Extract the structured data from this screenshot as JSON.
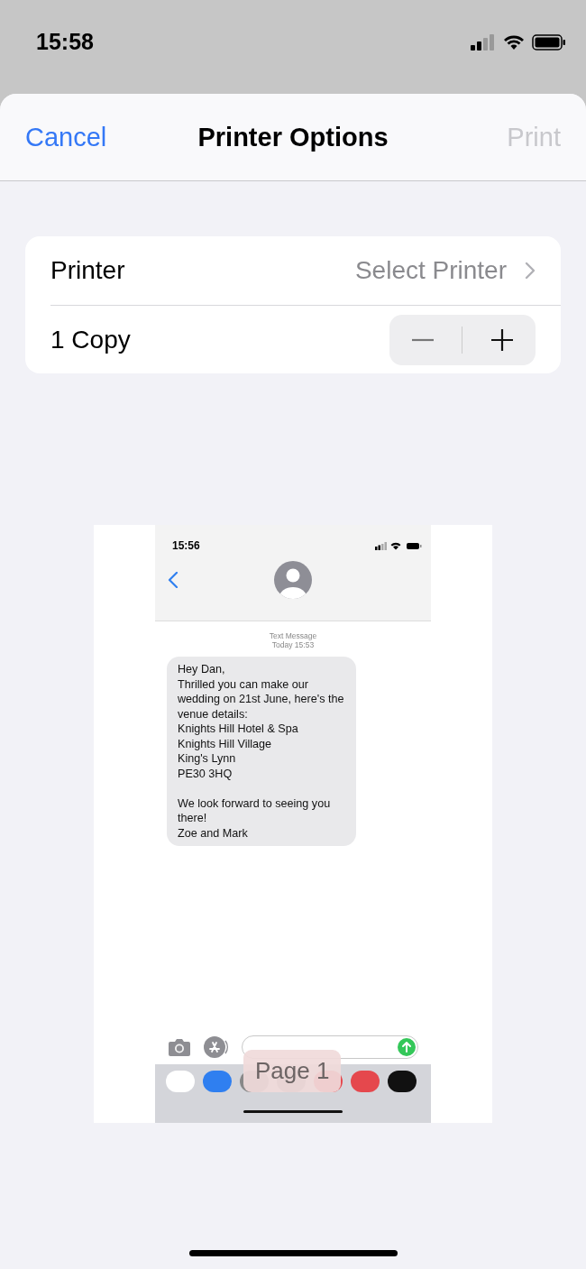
{
  "status_bar": {
    "time": "15:58"
  },
  "sheet": {
    "cancel": "Cancel",
    "title": "Printer Options",
    "print": {
      "label": "Print",
      "disabled": true
    }
  },
  "options": [
    {
      "kind": "link",
      "label": "Printer",
      "value": "Select Printer"
    },
    {
      "kind": "stepper",
      "label": "1 Copy"
    }
  ],
  "preview": {
    "status_time": "15:56",
    "header": "Text Message",
    "timestamp": "Today 15:53",
    "message": "Hey Dan,\nThrilled you can make our wedding on 21st June, here's the venue details:\nKnights Hill Hotel & Spa\nKnights Hill Village\nKing's Lynn\nPE30 3HQ\n\nWe look forward to seeing you there!\nZoe and Mark",
    "page_badge": "Page 1"
  }
}
